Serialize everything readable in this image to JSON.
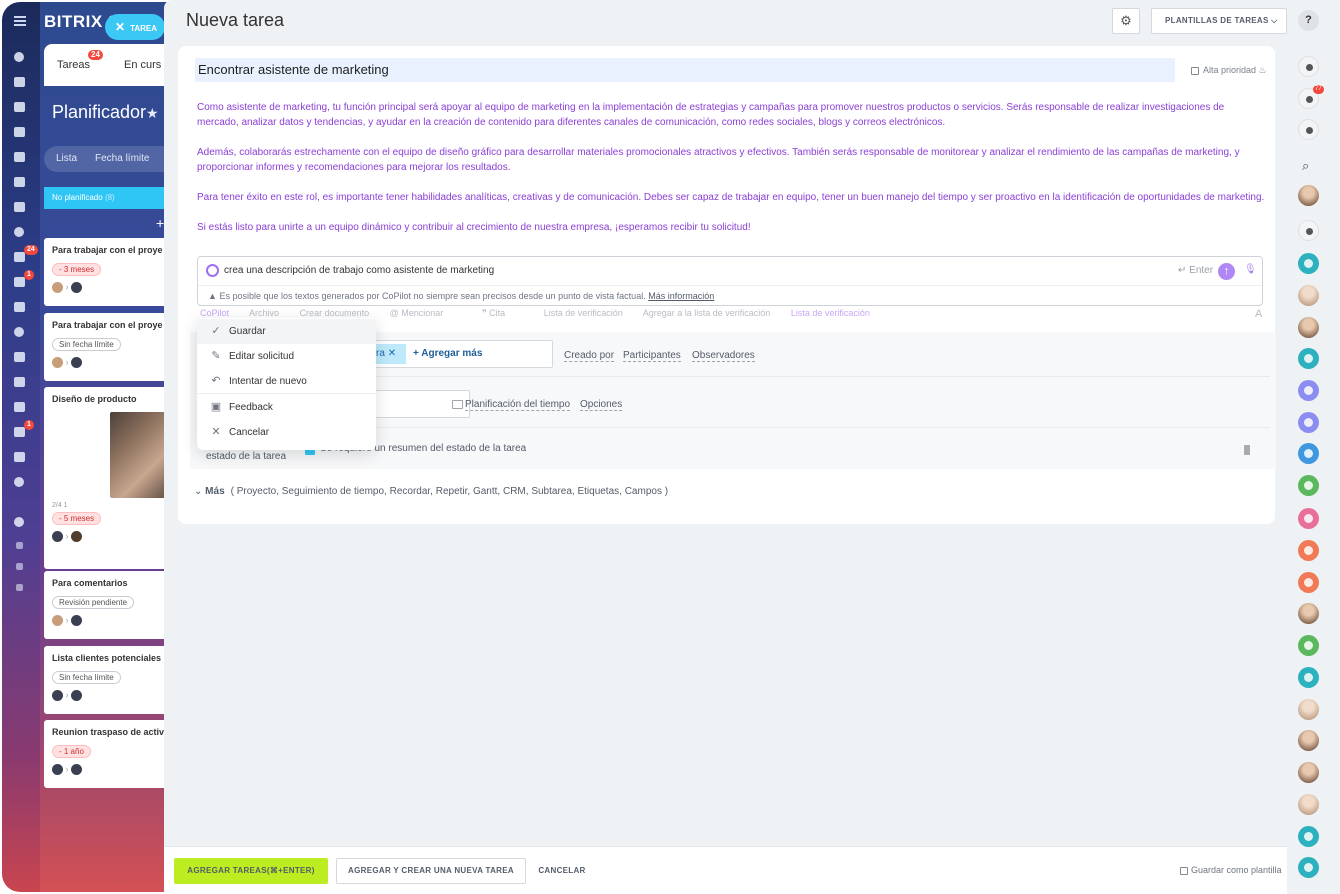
{
  "app": {
    "logo": "BITRIX 2",
    "close_label": "TAREA"
  },
  "left_rail": {
    "badges": {
      "tasks": "24",
      "feed": "1",
      "robot": "1"
    }
  },
  "portal": {
    "tabs": [
      {
        "label": "Tareas",
        "badge": "24"
      },
      {
        "label": "En curs"
      }
    ],
    "title": "Planificador",
    "views": [
      "Lista",
      "Fecha límite"
    ],
    "column": {
      "label": "No planificado",
      "count": "(8)"
    },
    "cards": [
      {
        "title": "Para trabajar con el proye",
        "tag": "- 3 meses",
        "tag_style": "red"
      },
      {
        "title": "Para trabajar con el proye",
        "tag": "Sin fecha límite",
        "tag_style": "gray"
      },
      {
        "title": "Diseño de producto",
        "meta": "2/4   1",
        "tag": "- 5 meses",
        "tag_style": "red"
      },
      {
        "title": "Para comentarios",
        "tag": "Revisión pendiente",
        "tag_style": "gray"
      },
      {
        "title": "Lista clientes potenciales",
        "tag": "Sin fecha límite",
        "tag_style": "gray"
      },
      {
        "title": "Reunion traspaso de activ",
        "tag": "- 1 año",
        "tag_style": "red"
      }
    ]
  },
  "header": {
    "title": "Nueva tarea",
    "templates_label": "PLANTILLAS DE TAREAS"
  },
  "task": {
    "title": "Encontrar asistente de marketing",
    "high_priority": "Alta prioridad",
    "description": [
      "Como asistente de marketing, tu función principal será apoyar al equipo de marketing en la implementación de estrategias y campañas para promover nuestros productos o servicios. Serás responsable de realizar investigaciones de mercado, analizar datos y tendencias, y ayudar en la creación de contenido para diferentes canales de comunicación, como redes sociales, blogs y correos electrónicos.",
      "Además, colaborarás estrechamente con el equipo de diseño gráfico para desarrollar materiales promocionales atractivos y efectivos. También serás responsable de monitorear y analizar el rendimiento de las campañas de marketing, y proporcionar informes y recomendaciones para mejorar los resultados.",
      "Para tener éxito en este rol, es importante tener habilidades analíticas, creativas y de comunicación. Debes ser capaz de trabajar en equipo, tener un buen manejo del tiempo y ser proactivo en la identificación de oportunidades de marketing.",
      "Si estás listo para unirte a un equipo dinámico y contribuir al crecimiento de nuestra empresa, ¡esperamos recibir tu solicitud!"
    ]
  },
  "copilot": {
    "prompt": "crea una descripción de trabajo como asistente de marketing",
    "enter_label": "Enter",
    "warning": "Es posible que los textos generados por CoPilot no siempre sean precisos desde un punto de vista factual.",
    "more_info": "Más información"
  },
  "toolbar": {
    "items": [
      "CoPilot",
      "Archivo",
      "Crear documento",
      "Mencionar",
      "Cita",
      "Lista de verificación",
      "Agregar a la lista de verificación",
      "Lista de verificación"
    ]
  },
  "menu": {
    "items": [
      {
        "label": "Guardar",
        "icon": "check-icon"
      },
      {
        "label": "Editar solicitud",
        "icon": "pencil-icon"
      },
      {
        "label": "Intentar de nuevo",
        "icon": "undo-icon"
      },
      {
        "label": "Feedback",
        "icon": "feedback-icon"
      },
      {
        "label": "Cancelar",
        "icon": "close-icon"
      }
    ]
  },
  "fields": {
    "responsible_chip": "ra",
    "add_more": "+ Agregar más",
    "created_by": "Creado por",
    "participants": "Participantes",
    "observers": "Observadores",
    "time_planning": "Planificación del tiempo",
    "options": "Opciones",
    "state_label": "estado de la tarea",
    "summary_required": "Se requiere un resumen del estado de la tarea",
    "more_label": "Más",
    "more_list": "( Proyecto,  Seguimiento de tiempo,  Recordar,  Repetir,  Gantt,  CRM,  Subtarea,  Etiquetas,  Campos )"
  },
  "footer": {
    "add_tasks": "AGREGAR TAREAS(⌘+ENTER)",
    "add_and_new": "AGREGAR Y CREAR UNA NUEVA TAREA",
    "cancel": "CANCELAR",
    "save_template": "Guardar como plantilla"
  },
  "right_rail": {
    "help": "?",
    "notifications_badge": "77"
  }
}
